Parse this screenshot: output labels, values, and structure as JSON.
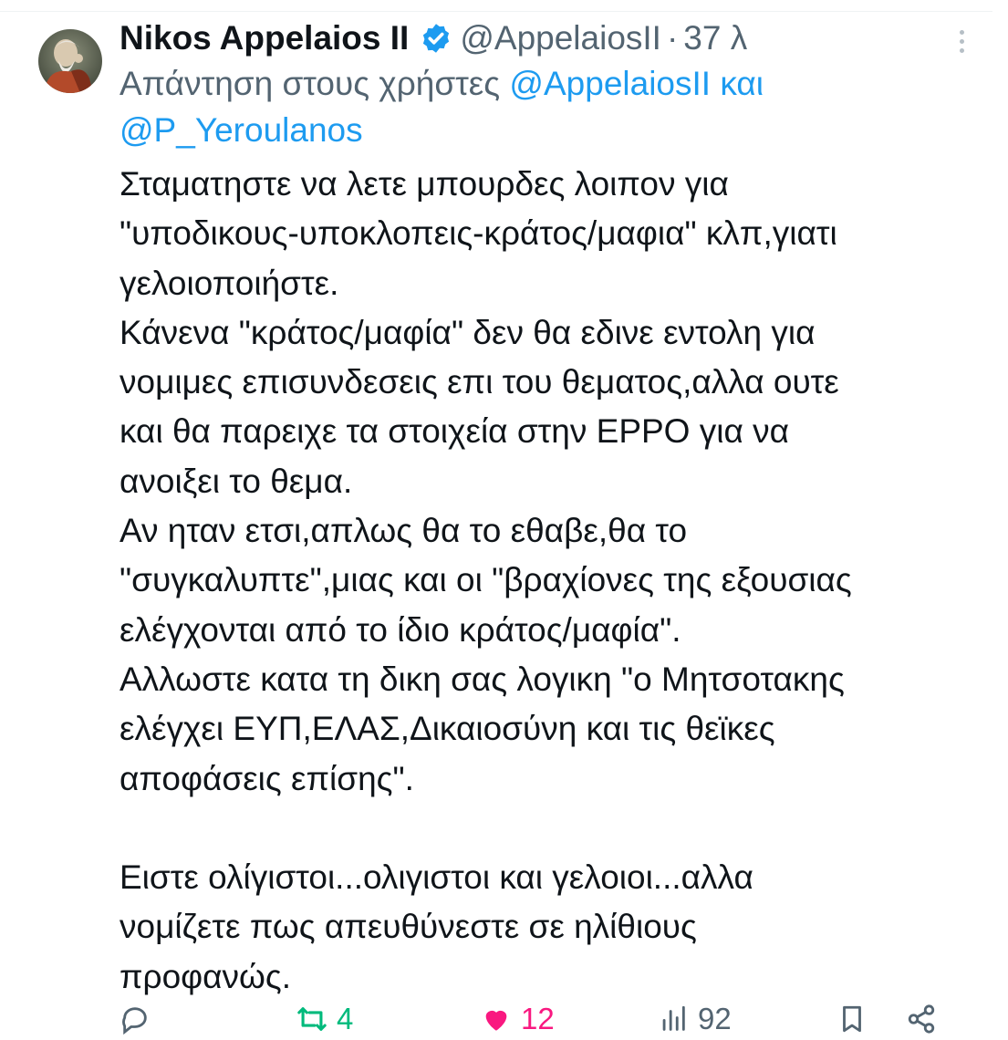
{
  "tweet": {
    "author": {
      "display_name": "Nikos Appelaios II",
      "handle": "@AppelaiosII",
      "separator": "·",
      "time": "37 λ",
      "verified": true
    },
    "reply_context": {
      "prefix": "Απάντηση στους χρήστες",
      "mention_1": "@AppelaiosII",
      "conjunction": "και",
      "mention_2": "@P_Yeroulanos"
    },
    "body_lines": [
      "Σταματηστε να λετε μπουρδες λοιπον για",
      "\"υποδικους-υποκλοπεις-κράτος/μαφια\" κλπ,γιατι",
      "γελοιοποιήστε.",
      "Κάνενα \"κράτος/μαφία\" δεν θα εδινε εντολη για",
      "νομιμες επισυνδεσεις επι του θεματος,αλλα ουτε",
      "και θα παρειχε τα στοιχεία στην ΕΡΡΟ για να",
      "ανοιξει το θεμα.",
      "Αν ηταν ετσι,απλως θα το εθαβε,θα το",
      "\"συγκαλυπτε\",μιας και οι \"βραχίονες της εξουσιας",
      "ελέγχονται από το ίδιο κράτος/μαφία\".",
      "Αλλωστε κατα τη δικη σας λογικη \"ο Μητσοτακης",
      "ελέγχει ΕΥΠ,ΕΛΑΣ,Δικαιοσύνη και τις θεϊκες",
      "αποφάσεις επίσης\".",
      "",
      "Ειστε ολίγιστοι...ολιγιστοι και γελοιοι...αλλα",
      "νομίζετε πως απευθύνεστε σε ηλίθιους",
      "προφανώς."
    ],
    "actions": {
      "reply": {
        "icon": "reply-icon",
        "count": ""
      },
      "retweet": {
        "icon": "retweet-icon",
        "count": "4"
      },
      "like": {
        "icon": "heart-icon",
        "count": "12"
      },
      "views": {
        "icon": "views-icon",
        "count": "92"
      },
      "bookmark": {
        "icon": "bookmark-icon",
        "count": ""
      },
      "share": {
        "icon": "share-icon",
        "count": ""
      }
    }
  },
  "colors": {
    "text": "#0f1419",
    "secondary": "#536471",
    "link": "#1d9bf0",
    "retweet_active": "#00ba7c",
    "like_active": "#f91880",
    "verified": "#1d9bf0"
  }
}
